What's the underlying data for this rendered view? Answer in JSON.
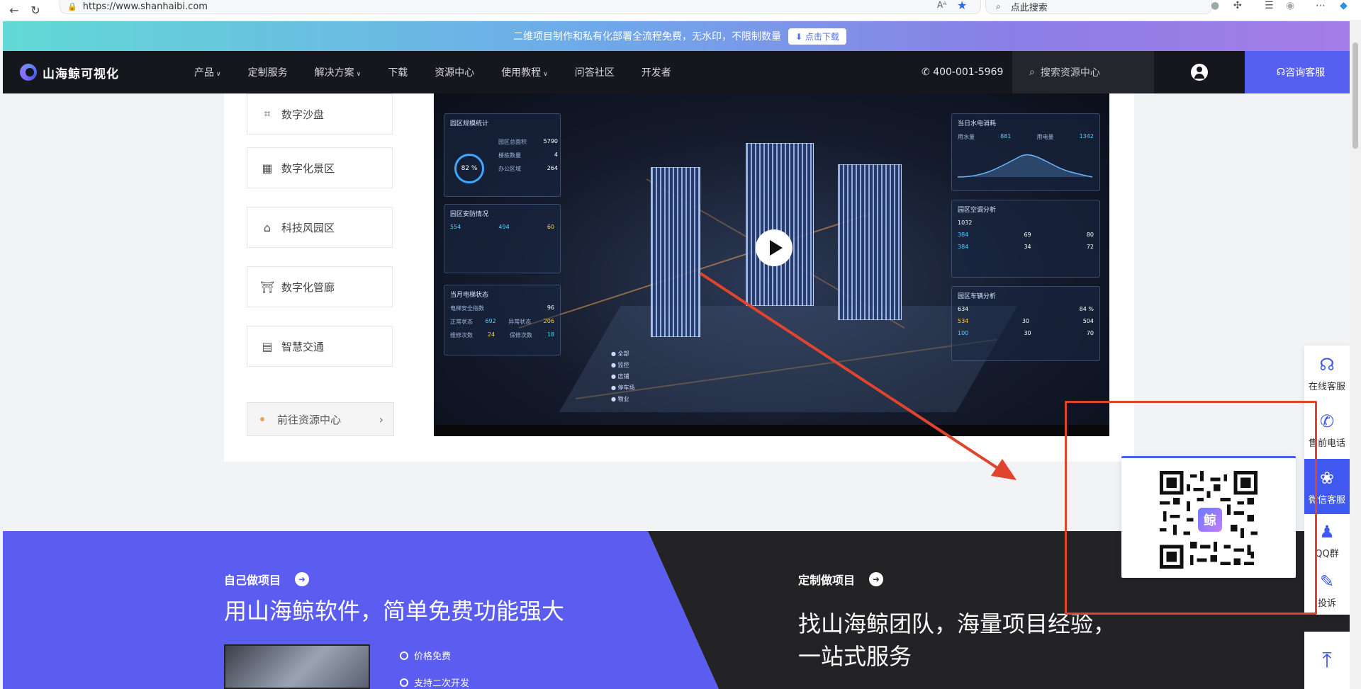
{
  "browser": {
    "url": "https://www.shanhaibi.com",
    "search_placeholder": "点此搜索"
  },
  "promo": {
    "text": "二维项目制作和私有化部署全流程免费，无水印，不限制数量",
    "button": "点击下载"
  },
  "nav": {
    "logo": "山海鲸可视化",
    "items": [
      {
        "label": "产品",
        "dropdown": true
      },
      {
        "label": "定制服务",
        "dropdown": false
      },
      {
        "label": "解决方案",
        "dropdown": true
      },
      {
        "label": "下载",
        "dropdown": false
      },
      {
        "label": "资源中心",
        "dropdown": false
      },
      {
        "label": "使用教程",
        "dropdown": true
      },
      {
        "label": "问答社区",
        "dropdown": false
      },
      {
        "label": "开发者",
        "dropdown": false
      }
    ],
    "phone": "400-001-5969",
    "search_placeholder": "搜索资源中心",
    "consult": "咨询客服"
  },
  "side": {
    "items": [
      "数字沙盘",
      "数字化景区",
      "科技风园区",
      "数字化管廊",
      "智慧交通"
    ],
    "goto": "前往资源中心"
  },
  "dashboard": {
    "panels": {
      "p1_title": "园区规模统计",
      "p1_gauge": "82 %",
      "p1_r1_label": "园区总面积",
      "p1_r1_value": "5790",
      "p1_r2_label": "楼栋数量",
      "p1_r2_value": "4",
      "p1_r3_label": "办公区域",
      "p1_r3_value": "264",
      "p2_title": "园区安防情况",
      "p2_r1a": "554",
      "p2_r1b": "494",
      "p2_r1c": "60",
      "p3_title": "当月电梯状态",
      "p3_r1_label": "电梯安全指数",
      "p3_r1_value": "96",
      "p3_r2_label": "正常状态",
      "p3_r2_value": "692",
      "p3_r2b_label": "异常状态",
      "p3_r2b_value": "206",
      "p3_r3_label": "维修次数",
      "p3_r3_value": "24",
      "p3_r3b_label": "保修次数",
      "p3_r3b_value": "18",
      "p4_title": "当日水电消耗",
      "p4_r1_label": "用水量",
      "p4_r1_value": "881",
      "p4_r1b_label": "用电量",
      "p4_r1b_value": "1342",
      "p5_title": "园区空调分析",
      "p5_r1_value": "1032",
      "p5_r2_value": "384",
      "p5_r2b_value": "69",
      "p5_r2c_value": "80",
      "p5_r3_value": "384",
      "p5_r3b_value": "34",
      "p5_r3c_value": "72",
      "p6_title": "园区车辆分析",
      "p6_r1_value": "634",
      "p6_r1b_value": "84 %",
      "p6_r2_value": "534",
      "p6_r2b_value": "30",
      "p6_r2c_value": "504",
      "p6_r3_value": "100",
      "p6_r3b_value": "30",
      "p6_r3c_value": "70"
    },
    "legend": [
      "全部",
      "监控",
      "店铺",
      "停车场",
      "物业"
    ]
  },
  "float_bar": {
    "items": [
      "在线客服",
      "售前电话",
      "微信客服",
      "QQ群",
      "投诉"
    ]
  },
  "qr_logo": "鲸",
  "bottom": {
    "left_sub": "自己做项目",
    "left_title": "用山海鲸软件，简单免费功能强大",
    "features": [
      "价格免费",
      "支持二次开发"
    ],
    "right_sub": "定制做项目",
    "right_title_1": "找山海鲸团队，海量项目经验，",
    "right_title_2": "一站式服务"
  },
  "colors": {
    "accent": "#5560f0",
    "nav_bg": "#16161d",
    "annotation_red": "#e0442c"
  }
}
